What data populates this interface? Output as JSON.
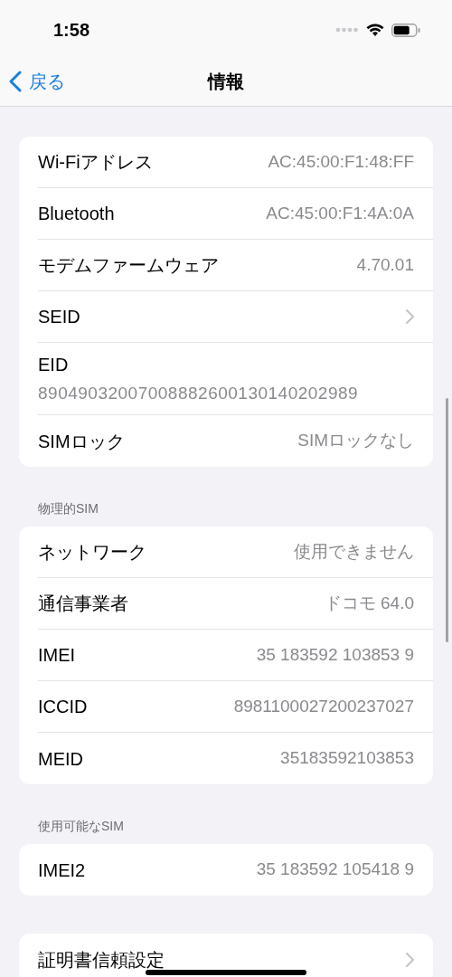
{
  "status_bar": {
    "time": "1:58"
  },
  "nav": {
    "back": "戻る",
    "title": "情報"
  },
  "sections": [
    {
      "rows": [
        {
          "kind": "value",
          "label": "Wi-Fiアドレス",
          "value": "AC:45:00:F1:48:FF"
        },
        {
          "kind": "value",
          "label": "Bluetooth",
          "value": "AC:45:00:F1:4A:0A"
        },
        {
          "kind": "value",
          "label": "モデムファームウェア",
          "value": "4.70.01"
        },
        {
          "kind": "chevron",
          "label": "SEID"
        },
        {
          "kind": "stacked",
          "label": "EID",
          "value": "89049032007008882600130140202989"
        },
        {
          "kind": "value",
          "label": "SIMロック",
          "value": "SIMロックなし"
        }
      ]
    },
    {
      "header": "物理的SIM",
      "rows": [
        {
          "kind": "value",
          "label": "ネットワーク",
          "value": "使用できません"
        },
        {
          "kind": "value",
          "label": "通信事業者",
          "value": "ドコモ 64.0"
        },
        {
          "kind": "value",
          "label": "IMEI",
          "value": "35 183592 103853 9"
        },
        {
          "kind": "value",
          "label": "ICCID",
          "value": "8981100027200237027"
        },
        {
          "kind": "value",
          "label": "MEID",
          "value": "35183592103853"
        }
      ]
    },
    {
      "header": "使用可能なSIM",
      "rows": [
        {
          "kind": "value",
          "label": "IMEI2",
          "value": "35 183592 105418 9"
        }
      ]
    },
    {
      "rows": [
        {
          "kind": "chevron",
          "label": "証明書信頼設定"
        }
      ]
    }
  ]
}
